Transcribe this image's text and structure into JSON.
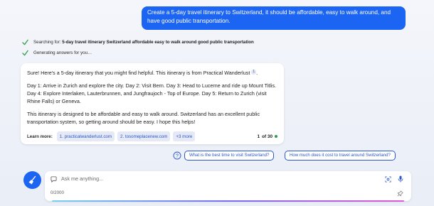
{
  "user_message": "Create a 5-day travel itinerary to Switzerland, it should be affordable, easy to walk around, and have good public transportation.",
  "status": {
    "searching_prefix": "Searching for: ",
    "searching_query": "5-day travel itinerary Switzerland affordable easy to walk around good public transportation",
    "generating": "Generating answers for you…"
  },
  "answer": {
    "intro": "Sure! Here's a 5-day itinerary that you might find helpful. This itinerary is from Practical Wanderlust",
    "intro_cite": "1",
    "intro_end": ".",
    "itinerary": "Day 1: Arrive in Zurich and explore the city. Day 2: Visit Bern. Day 3: Head to Lucerne and ride up Mount Titlis. Day 4: Explore Interlaken, Lauterbrunnen, and Jungfraujoch - Top of Europe. Day 5: Return to Zurich (visit Rhine Falls) or Geneva.",
    "closing": "This itinerary is designed to be affordable and easy to walk around. Switzerland has an excellent public transportation system, so getting around should be easy. I hope this helps!",
    "learn_more_label": "Learn more:",
    "sources": [
      "1. practicalwanderlust.com",
      "2. tosomeplacenew.com"
    ],
    "more_sources": "+3 more",
    "page_current": "1",
    "page_total": "of 30"
  },
  "suggestions": [
    "What is the best time to visit Switzerland?",
    "How much does it cost to travel around Switzerland?"
  ],
  "input": {
    "placeholder": "Ask me anything...",
    "char_count": "0/2000"
  },
  "colors": {
    "accent": "#1c64f2",
    "link": "#2a56c6",
    "success": "#2e9d44"
  },
  "icons": [
    "check-icon",
    "sparkle-question-icon",
    "broom-icon",
    "chat-bubble-icon",
    "scan-icon",
    "mic-icon",
    "pin-icon"
  ]
}
